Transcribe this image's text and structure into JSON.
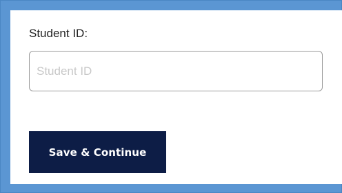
{
  "form": {
    "student_id_label": "Student ID:",
    "student_id_placeholder": "Student ID",
    "student_id_value": "",
    "save_label": "Save & Continue"
  },
  "colors": {
    "frame_border": "#5b96d3",
    "button_background": "#0d1d46",
    "button_text": "#ffffff",
    "placeholder_text": "#c8c8c8"
  }
}
